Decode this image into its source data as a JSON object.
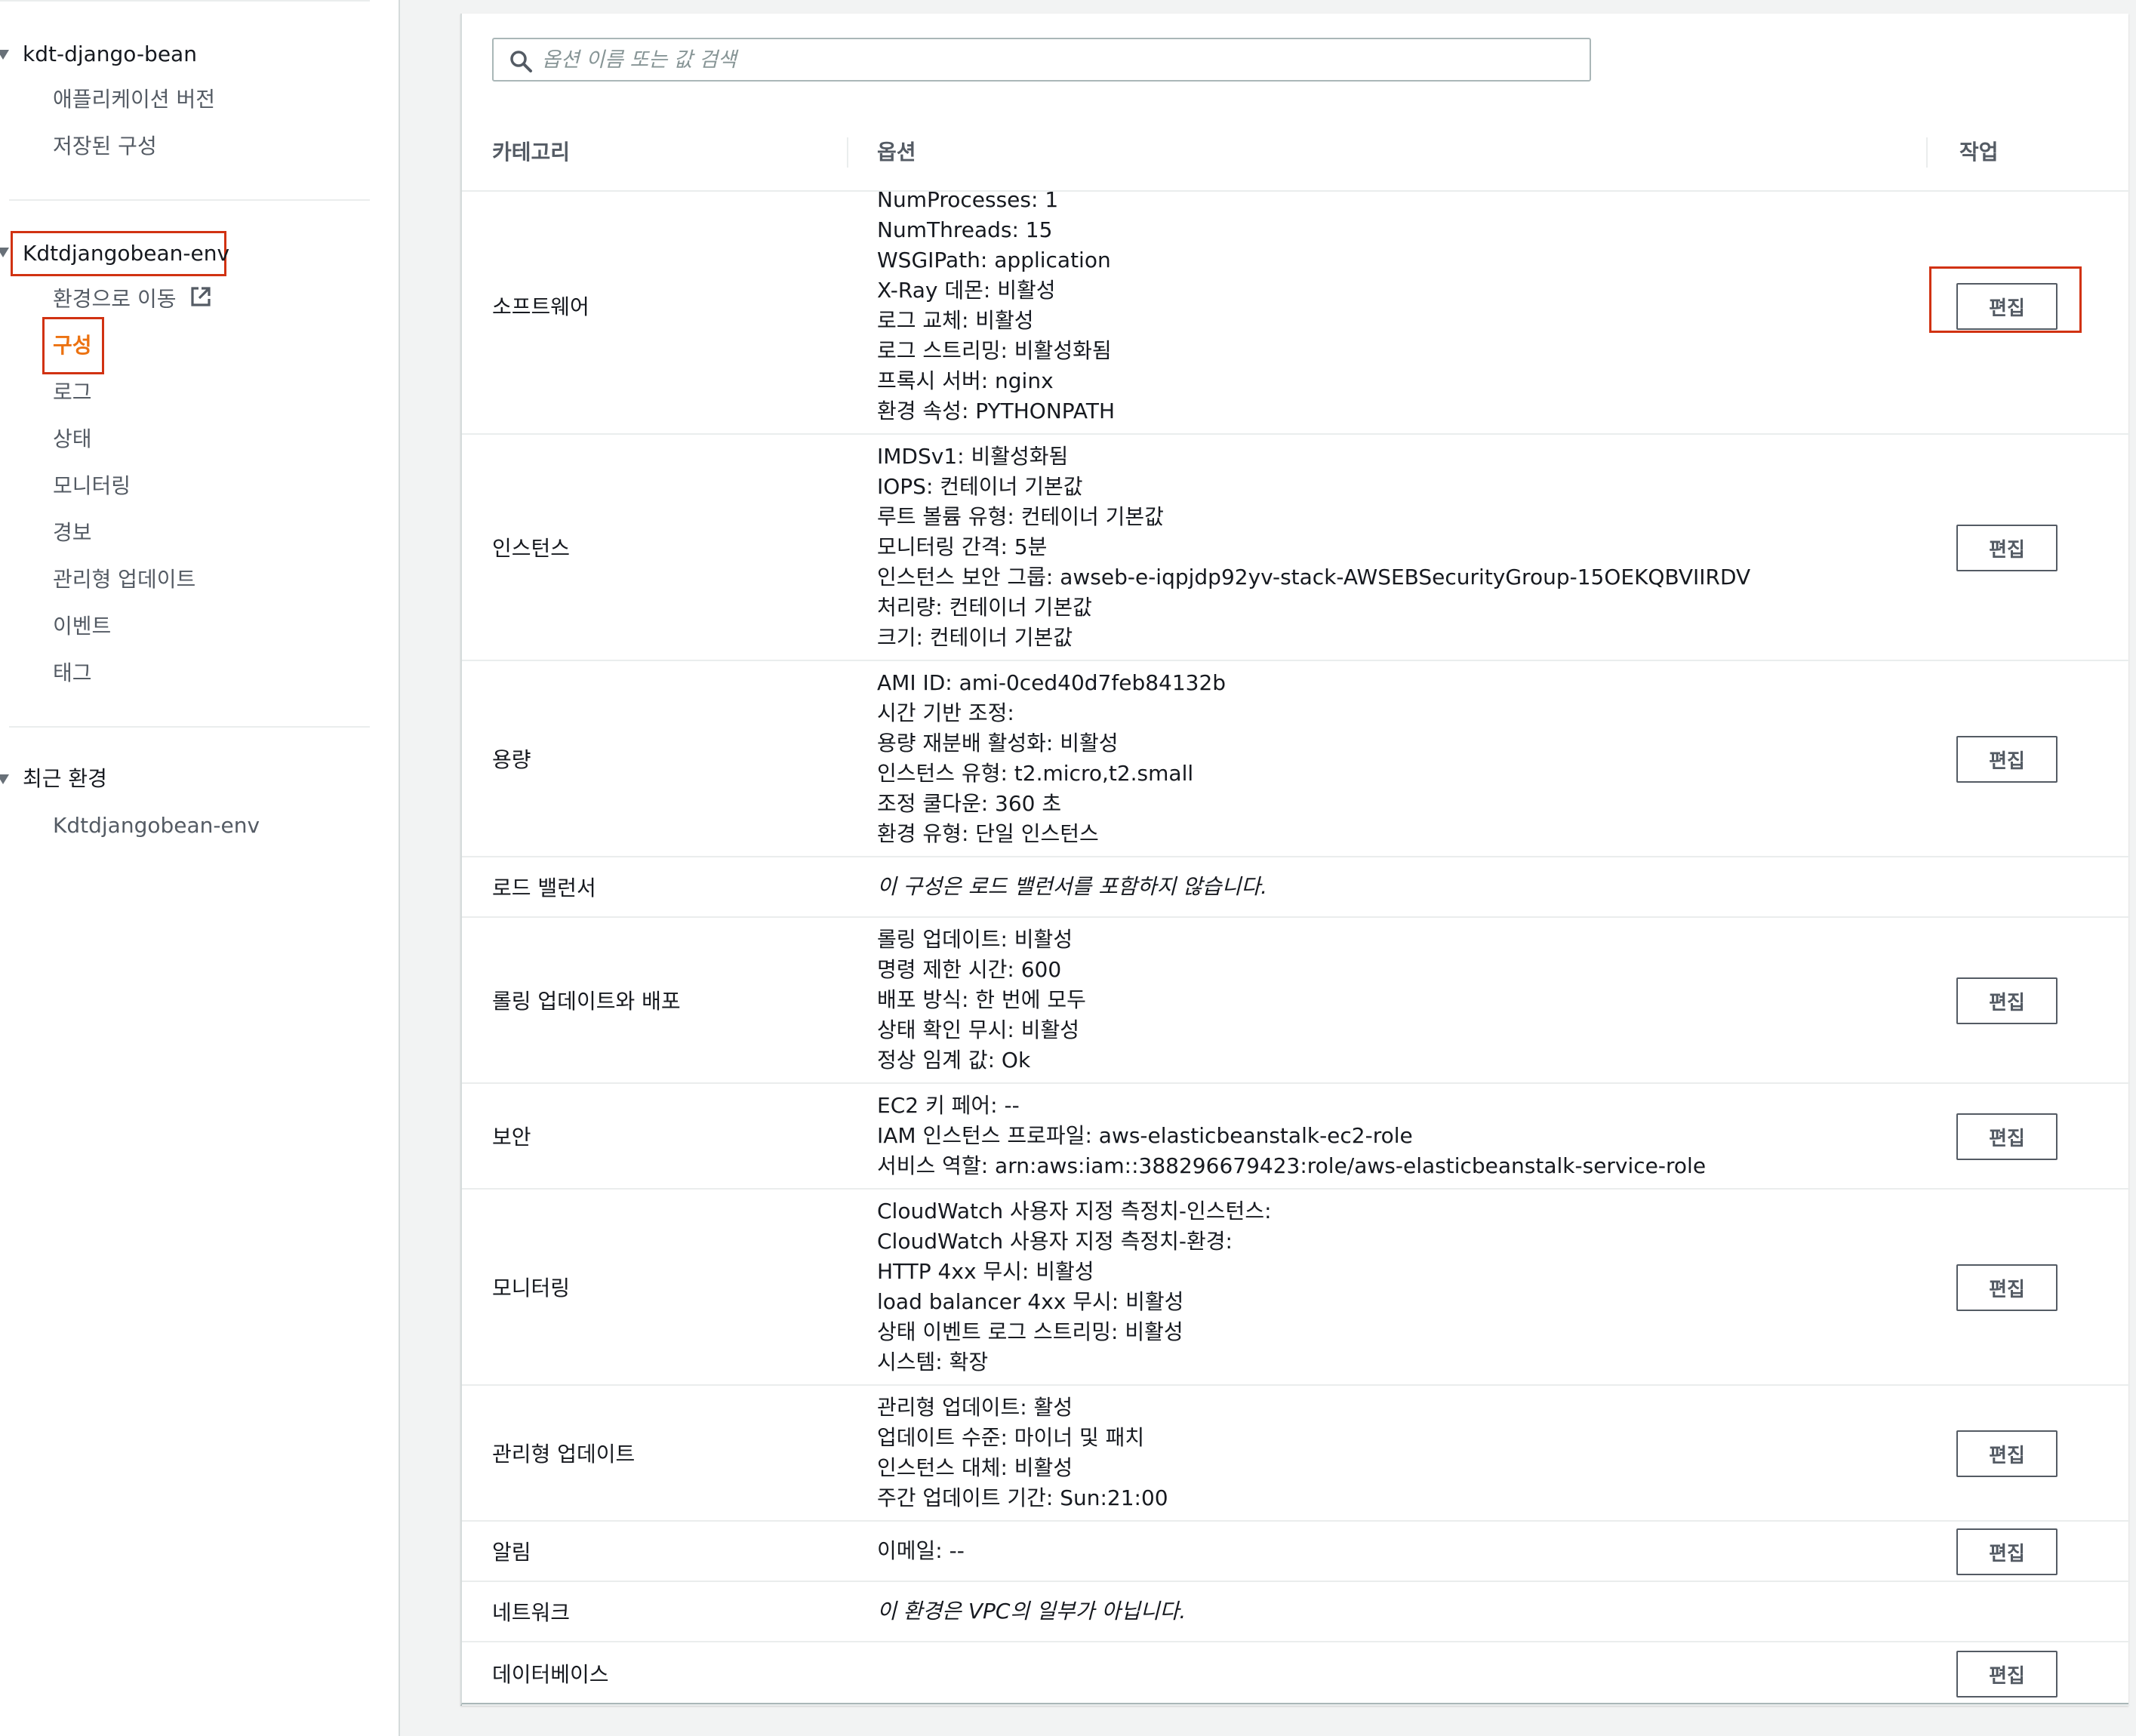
{
  "sidebar": {
    "app_name": "kdt-django-bean",
    "app_items": [
      "애플리케이션 버전",
      "저장된 구성"
    ],
    "env_name": "Kdtdjangobean-env",
    "env_items": [
      "환경으로 이동",
      "구성",
      "로그",
      "상태",
      "모니터링",
      "경보",
      "관리형 업데이트",
      "이벤트",
      "태그"
    ],
    "active_item": "구성",
    "recent_header": "최근 환경",
    "recent_items": [
      "Kdtdjangobean-env"
    ]
  },
  "search": {
    "placeholder": "옵션 이름 또는 값 검색"
  },
  "table": {
    "headers": {
      "category": "카테고리",
      "options": "옵션",
      "actions": "작업"
    },
    "edit_label": "편집",
    "rows": [
      {
        "category": "소프트웨어",
        "options": [
          "NumProcesses: 1",
          "NumThreads: 15",
          "WSGIPath: application",
          "X-Ray 데몬: 비활성",
          "로그 교체: 비활성",
          "로그 스트리밍: 비활성화됨",
          "프록시 서버: nginx",
          "환경 속성: PYTHONPATH"
        ],
        "editable": true
      },
      {
        "category": "인스턴스",
        "options": [
          "IMDSv1: 비활성화됨",
          "IOPS: 컨테이너 기본값",
          "루트 볼륨 유형: 컨테이너 기본값",
          "모니터링 간격: 5분",
          "인스턴스 보안 그룹: awseb-e-iqpjdp92yv-stack-AWSEBSecurityGroup-15OEKQBVIIRDV",
          "처리량: 컨테이너 기본값",
          "크기: 컨테이너 기본값"
        ],
        "editable": true
      },
      {
        "category": "용량",
        "options": [
          "AMI ID: ami-0ced40d7feb84132b",
          "시간 기반 조정:",
          "용량 재분배 활성화: 비활성",
          "인스턴스 유형: t2.micro,t2.small",
          "조정 쿨다운: 360 초",
          "환경 유형: 단일 인스턴스"
        ],
        "editable": true
      },
      {
        "category": "로드 밸런서",
        "options": [
          "이 구성은 로드 밸런서를 포함하지 않습니다."
        ],
        "italic": true,
        "editable": false
      },
      {
        "category": "롤링 업데이트와 배포",
        "options": [
          "롤링 업데이트: 비활성",
          "명령 제한 시간: 600",
          "배포 방식: 한 번에 모두",
          "상태 확인 무시: 비활성",
          "정상 임계 값: Ok"
        ],
        "editable": true
      },
      {
        "category": "보안",
        "options": [
          "EC2 키 페어: --",
          "IAM 인스턴스 프로파일: aws-elasticbeanstalk-ec2-role",
          "서비스 역할: arn:aws:iam::388296679423:role/aws-elasticbeanstalk-service-role"
        ],
        "editable": true
      },
      {
        "category": "모니터링",
        "options": [
          "CloudWatch 사용자 지정 측정치-인스턴스:",
          "CloudWatch 사용자 지정 측정치-환경:",
          "HTTP 4xx 무시: 비활성",
          "load balancer 4xx 무시: 비활성",
          "상태 이벤트 로그 스트리밍: 비활성",
          "시스템: 확장"
        ],
        "editable": true
      },
      {
        "category": "관리형 업데이트",
        "options": [
          "관리형 업데이트: 활성",
          "업데이트 수준: 마이너 및 패치",
          "인스턴스 대체: 비활성",
          "주간 업데이트 기간: Sun:21:00"
        ],
        "editable": true
      },
      {
        "category": "알림",
        "options": [
          "이메일: --"
        ],
        "editable": true
      },
      {
        "category": "네트워크",
        "options": [
          "이 환경은 VPC의 일부가 아닙니다."
        ],
        "italic": true,
        "editable": false
      },
      {
        "category": "데이터베이스",
        "options": [],
        "editable": true
      }
    ]
  },
  "colors": {
    "accent": "#ec7211",
    "highlight_box": "#d13212",
    "border": "#eaeded"
  }
}
